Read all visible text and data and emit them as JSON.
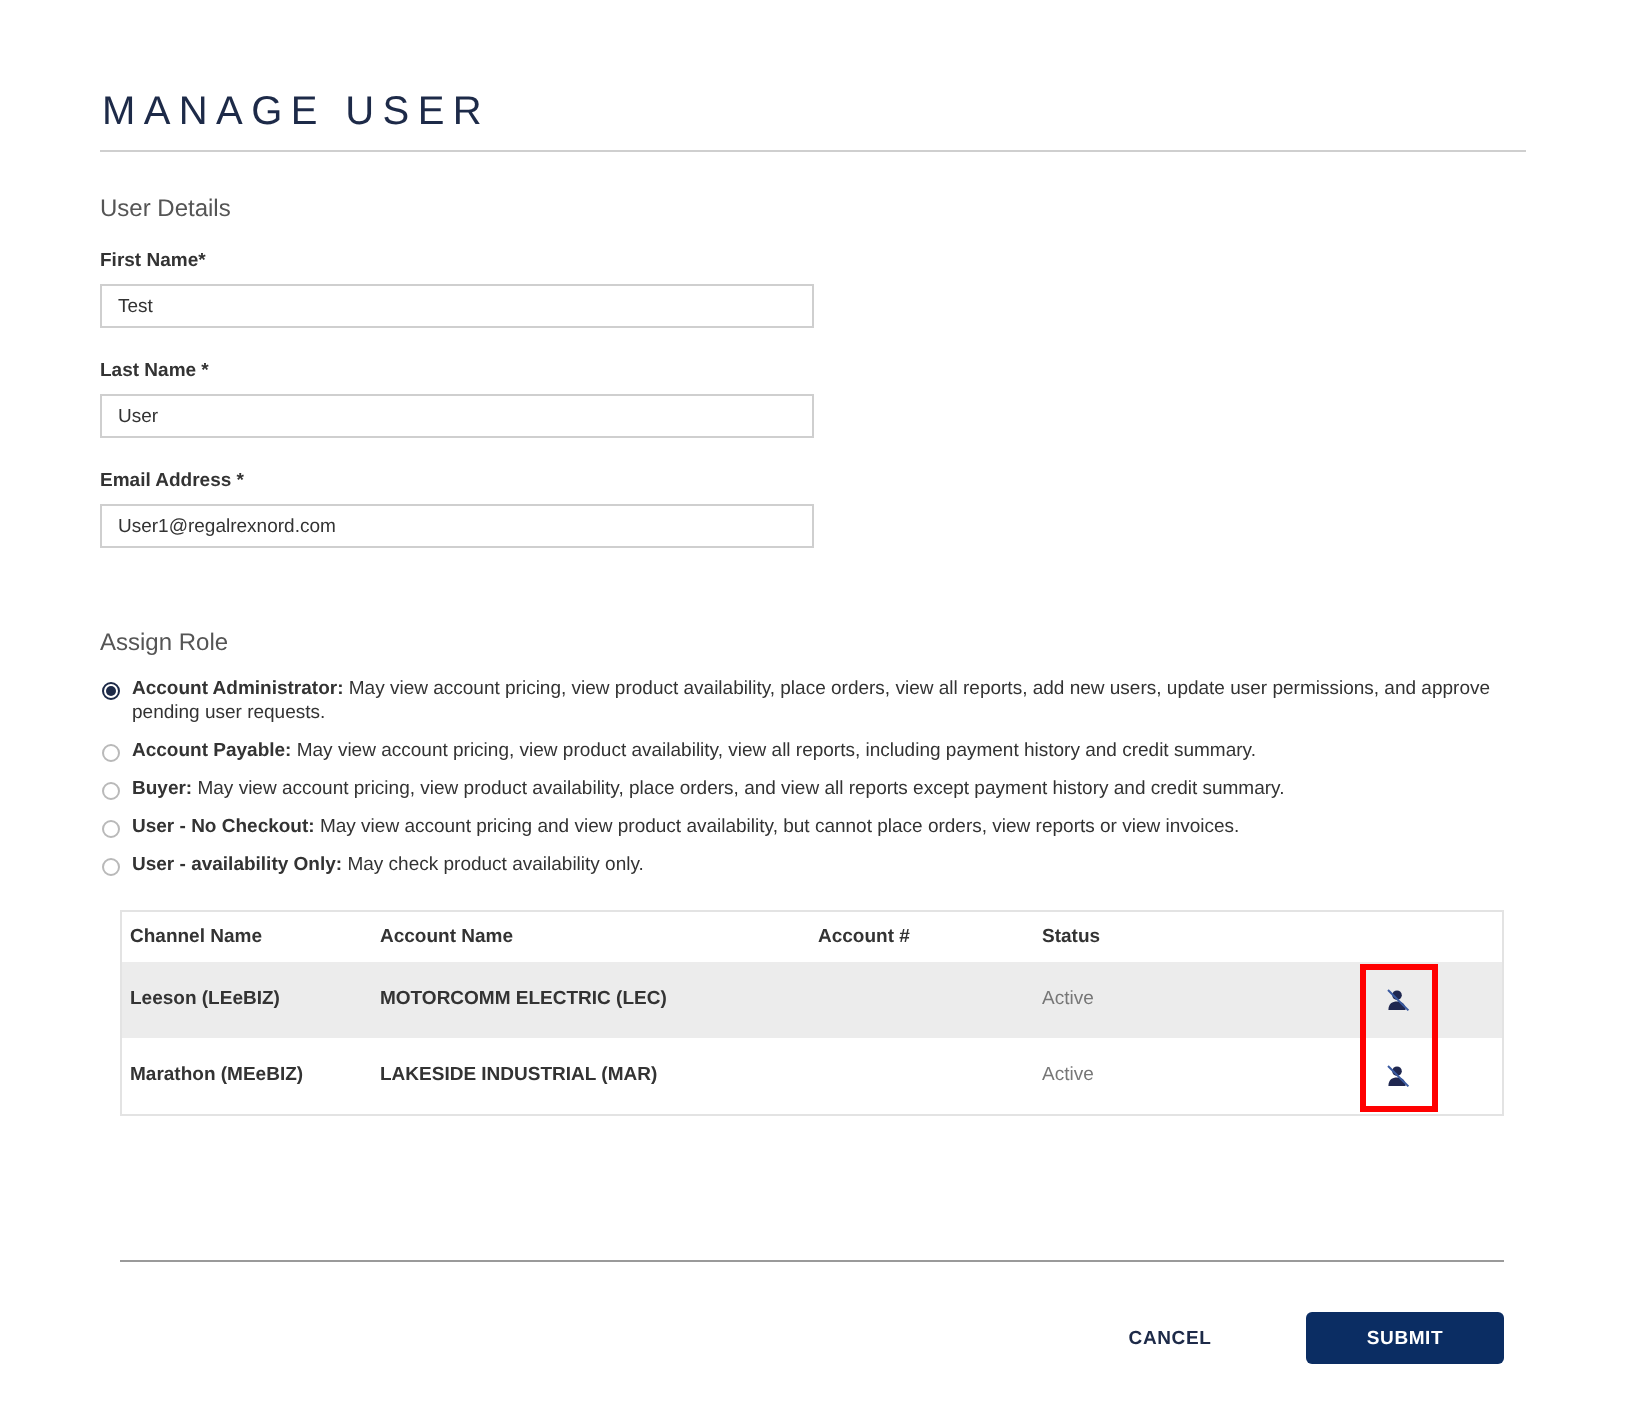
{
  "title": "MANAGE USER",
  "user_details": {
    "heading": "User Details",
    "fields": [
      {
        "label": "First Name*",
        "value": "Test"
      },
      {
        "label": "Last Name *",
        "value": "User"
      },
      {
        "label": "Email Address *",
        "value": "User1@regalrexnord.com"
      }
    ]
  },
  "assign_role": {
    "heading": "Assign Role",
    "roles": [
      {
        "text": "**Account Administrator:** May view account pricing, view product availability, place orders, view all reports, add new users, update user permissions, and approve pending user requests.",
        "selected": true
      },
      {
        "text": "**Account Payable:** May view account pricing, view product availability, view all reports, including payment history and credit summary.",
        "selected": false
      },
      {
        "text": "**Buyer:** May view account pricing, view product availability, place orders, and view all reports except payment history and credit summary.",
        "selected": false
      },
      {
        "text": "**User - No Checkout:** May view account pricing and view product availability, but cannot place orders, view reports or view invoices.",
        "selected": false
      },
      {
        "text": "**User - availability Only:** May check product availability only.",
        "selected": false
      }
    ]
  },
  "accounts_table": {
    "columns": [
      "Channel Name",
      "Account Name",
      "Account #",
      "Status"
    ],
    "rows": [
      {
        "channel_name": "Leeson (LEeBIZ)",
        "account_name": "MOTORCOMM ELECTRIC (LEC)",
        "status": "Active",
        "highlighted": true
      },
      {
        "channel_name": "Marathon (MEeBIZ)",
        "account_name": "LAKESIDE INDUSTRIAL (MAR)",
        "status": "Active",
        "highlighted": false
      }
    ],
    "highlight_frame": true
  },
  "buttons": [
    {
      "kind": "text",
      "label": "CANCEL"
    },
    {
      "kind": "primary",
      "label": "SUBMIT"
    }
  ]
}
